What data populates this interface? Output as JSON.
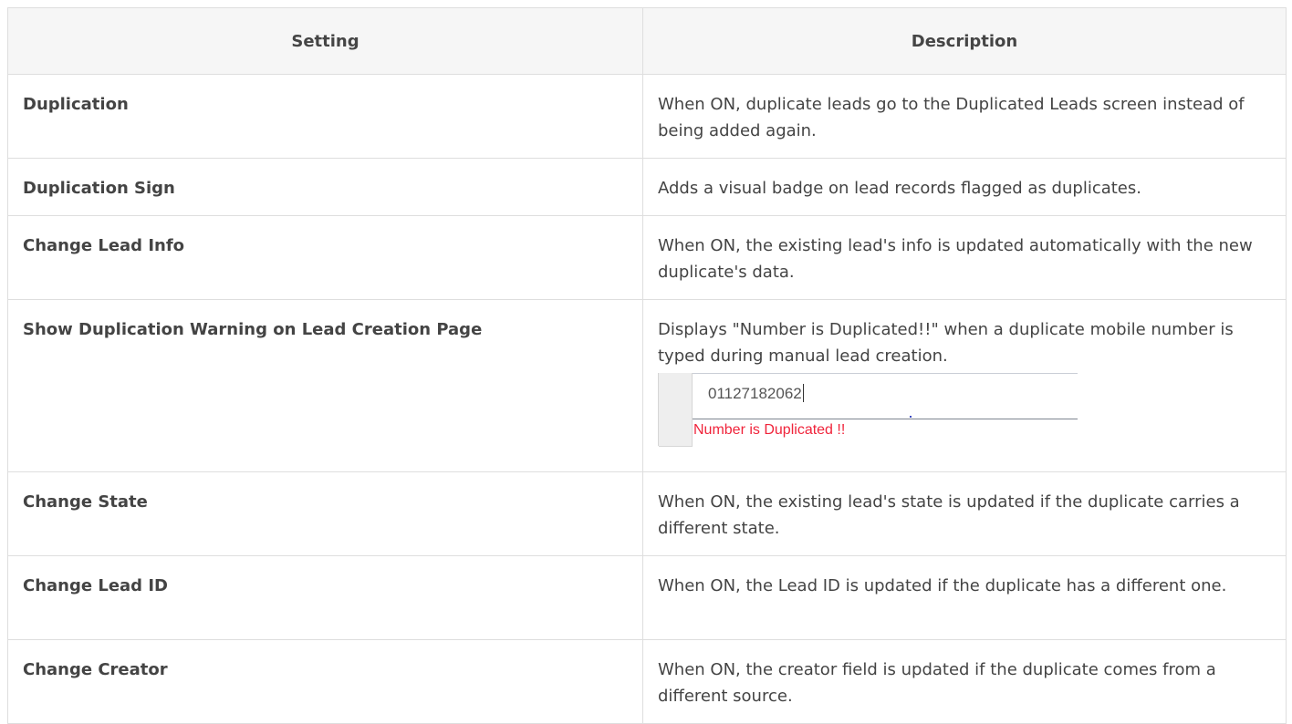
{
  "table": {
    "headers": {
      "setting": "Setting",
      "description": "Description"
    },
    "rows": [
      {
        "setting": "Duplication",
        "description": "When ON, duplicate leads go to the Duplicated Leads screen instead of being added again."
      },
      {
        "setting": "Duplication Sign",
        "description": "Adds a visual badge on lead records flagged as duplicates."
      },
      {
        "setting": "Change Lead Info",
        "description": "When ON, the existing lead's info is updated automatically with the new duplicate's data."
      },
      {
        "setting": "Show Duplication Warning on Lead Creation Page",
        "description": "Displays \"Number is Duplicated!!\" when a duplicate mobile number is typed during manual lead creation."
      },
      {
        "setting": "Change State",
        "description": "When ON, the existing lead's state is updated if the duplicate carries a different state."
      },
      {
        "setting": "Change Lead ID",
        "description": "When ON, the Lead ID is updated if the duplicate has a different one."
      },
      {
        "setting": "Change Creator",
        "description": "When ON, the creator field is updated if the duplicate comes from a different source."
      }
    ]
  },
  "warning_example": {
    "field_value": "01127182062",
    "error_text": "Number is Duplicated !!",
    "error_color": "#f0243b"
  }
}
